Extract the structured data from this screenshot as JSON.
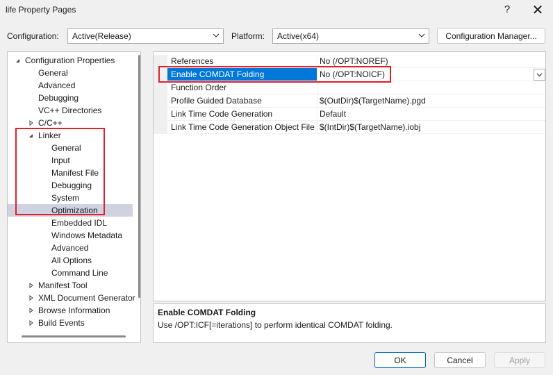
{
  "window": {
    "title": "life Property Pages",
    "help_glyph": "?",
    "close_glyph": "✕"
  },
  "config_bar": {
    "configuration_label": "Configuration:",
    "configuration_value": "Active(Release)",
    "platform_label": "Platform:",
    "platform_value": "Active(x64)",
    "manager_button": "Configuration Manager..."
  },
  "tree": {
    "items": [
      {
        "label": "Configuration Properties",
        "level": 0,
        "expander": "open"
      },
      {
        "label": "General",
        "level": 1,
        "expander": "none"
      },
      {
        "label": "Advanced",
        "level": 1,
        "expander": "none"
      },
      {
        "label": "Debugging",
        "level": 1,
        "expander": "none"
      },
      {
        "label": "VC++ Directories",
        "level": 1,
        "expander": "none"
      },
      {
        "label": "C/C++",
        "level": 1,
        "expander": "closed"
      },
      {
        "label": "Linker",
        "level": 1,
        "expander": "open"
      },
      {
        "label": "General",
        "level": 2,
        "expander": "none"
      },
      {
        "label": "Input",
        "level": 2,
        "expander": "none"
      },
      {
        "label": "Manifest File",
        "level": 2,
        "expander": "none"
      },
      {
        "label": "Debugging",
        "level": 2,
        "expander": "none"
      },
      {
        "label": "System",
        "level": 2,
        "expander": "none"
      },
      {
        "label": "Optimization",
        "level": 2,
        "expander": "none",
        "selected": true
      },
      {
        "label": "Embedded IDL",
        "level": 2,
        "expander": "none"
      },
      {
        "label": "Windows Metadata",
        "level": 2,
        "expander": "none"
      },
      {
        "label": "Advanced",
        "level": 2,
        "expander": "none"
      },
      {
        "label": "All Options",
        "level": 2,
        "expander": "none"
      },
      {
        "label": "Command Line",
        "level": 2,
        "expander": "none"
      },
      {
        "label": "Manifest Tool",
        "level": 1,
        "expander": "closed"
      },
      {
        "label": "XML Document Generator",
        "level": 1,
        "expander": "closed"
      },
      {
        "label": "Browse Information",
        "level": 1,
        "expander": "closed"
      },
      {
        "label": "Build Events",
        "level": 1,
        "expander": "closed"
      }
    ]
  },
  "properties": {
    "rows": [
      {
        "name": "References",
        "value": "No (/OPT:NOREF)"
      },
      {
        "name": "Enable COMDAT Folding",
        "value": "No (/OPT:NOICF)",
        "selected": true
      },
      {
        "name": "Function Order",
        "value": ""
      },
      {
        "name": "Profile Guided Database",
        "value": "$(OutDir)$(TargetName).pgd"
      },
      {
        "name": "Link Time Code Generation",
        "value": "Default"
      },
      {
        "name": "Link Time Code Generation Object File",
        "value": "$(IntDir)$(TargetName).iobj"
      }
    ]
  },
  "description": {
    "title": "Enable COMDAT Folding",
    "text": "Use /OPT:ICF[=iterations] to perform identical COMDAT folding."
  },
  "buttons": {
    "ok": "OK",
    "cancel": "Cancel",
    "apply": "Apply"
  },
  "colors": {
    "highlight_box": "#e3202a",
    "selection_blue": "#0078d7",
    "tree_selection": "#cfd2e0"
  }
}
